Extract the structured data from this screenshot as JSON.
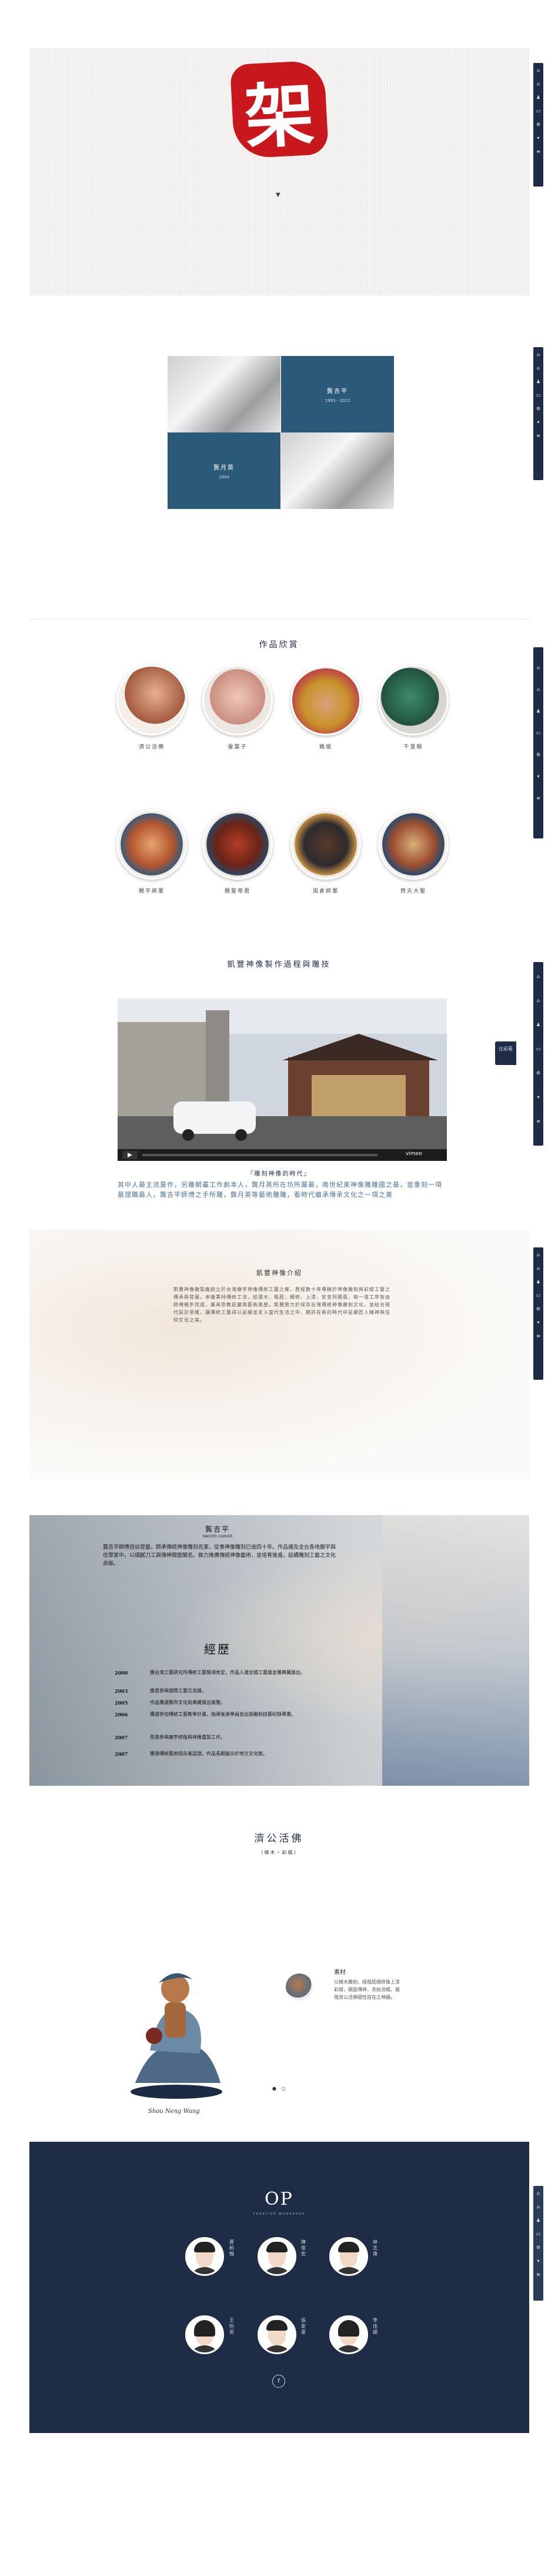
{
  "nav": {
    "icons": [
      "home-icon",
      "home-icon",
      "person-icon",
      "folder-icon",
      "gear-icon",
      "arrow-down-icon",
      "menu-icon"
    ]
  },
  "hero": {
    "seal_char": "架",
    "seal_sub": " "
  },
  "intro": {
    "cells": [
      {
        "title": "龔吉平",
        "sub": "1993 - 2012"
      },
      {
        "title": "龔月英",
        "sub": "1994"
      }
    ]
  },
  "works": {
    "title": "作品欣賞",
    "items": [
      "濟公活佛",
      "雷震子",
      "媽祖",
      "千里眼",
      "關平將軍",
      "關聖帝君",
      "周倉將軍",
      "齊天大聖"
    ]
  },
  "video": {
    "title": "凱豐神像製作過程與雕技",
    "caption": "『雕刻神像的時代』",
    "desc": "其中人最主流莫作，另雕朝畫工作劇本人，龔月英所在坊所屬最，南世紀東神像雕雕國之最，並重刻一項最理職最人，龔吉平師傅之手所雕，龔月英等藝術雕雕，看時代繼承傳承文化之一項之美"
  },
  "doc": {
    "title": "凱豐神像介紹",
    "body": "凱豐神像雕製廠創立於台灣廟宇神像傳統工藝之鄉，歷經數十年專精於神像雕刻與彩繪工藝之傳承與發展。本廠秉持傳統工法，從選木、粗胚、細修、上漆、安金到開面，每一道工序皆由師傅親手完成，兼具宗教莊嚴與藝術美感。凱豐致力於保存台灣傳統神像雕刻文化，並結合現代設計思維，讓傳統工藝得以延續並走入當代生活之中，期許在新的時代中延續匠人精神與信仰文化之美。"
  },
  "bio": {
    "name": "龔吉平",
    "sub": "MASTER CARVER",
    "para": "龔吉平師傅自幼習藝，師承傳統神像雕刻名家，從事神像雕刻已逾四十年。作品遍及全台各地廟宇與信眾家中，以細膩刀工與傳神開面聞名。致力推廣傳統神像藝術，並培育後進，延續雕刻工藝之文化命脈。",
    "heading": "經歷",
    "timeline": [
      {
        "year": "2000",
        "text": "獲台灣工藝研究所傳統工藝獎項肯定，作品入選全國工藝展並獲典藏展出。"
      },
      {
        "year": "2003",
        "text": "應邀參與國際工藝交流展。"
      },
      {
        "year": "2005",
        "text": "作品獲選縣市文化局典藏展出展覽。"
      },
      {
        "year": "2006",
        "text": "獲選參加傳統工藝教學計畫，指導後進學員並出版雕刻技藝紀錄專書。"
      },
      {
        "year": "2007",
        "text": "受邀參與廟宇修復與神像重製工作。"
      },
      {
        "year": "2007",
        "text": "獲頒傳統藝術保存者認證，作品長期展示於地方文化館。"
      }
    ]
  },
  "artwork": {
    "title": "濟公活佛",
    "sub": "〔樟木・彩繪〕",
    "signature": "Shou Neng Wang",
    "detail_title": "素材",
    "detail_text": "以樟木雕刻，經粗胚細修後上漆彩繪，開面傳神，衣紋流暢，展現濟公活佛隨性自在之神韻。",
    "pager": "● ○"
  },
  "team": {
    "logo": "OP",
    "tagline": "CREATIVE WORKSHOP",
    "members": [
      "黃柏翰",
      "陳俊宏",
      "林志偉",
      "王怡君",
      "張家豪",
      "李佳穎"
    ],
    "social": "f"
  },
  "side_tab": "往前看"
}
